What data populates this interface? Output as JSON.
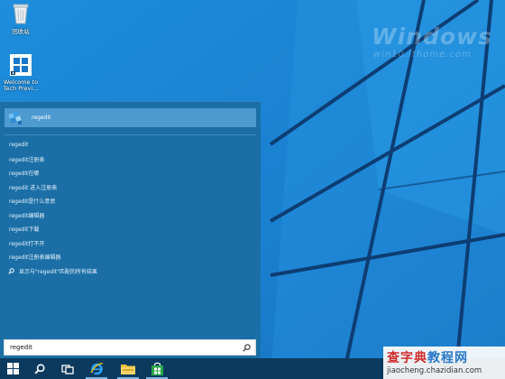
{
  "colors": {
    "desktop": "#1b86d6",
    "start_panel": "#1b6fa6",
    "selected_result": "#4d9ad0",
    "taskbar": "#0c3a5e",
    "brand_red": "#d12b2b",
    "brand_blue": "#2a78c8"
  },
  "desktop": {
    "watermark_title": "Windows",
    "watermark_url": "win10.ithome.com",
    "icons": [
      {
        "label": "回收站",
        "icon": "recycle-bin-icon"
      },
      {
        "label": "Welcome to Tech Previ...",
        "icon": "windows-logo-icon"
      }
    ]
  },
  "start": {
    "top_result": {
      "label": "regedit",
      "icon": "regedit-app-icon"
    },
    "suggestions": [
      "regedit",
      "regedit注册表",
      "regedit在哪",
      "regedit 进入注册表",
      "regedit是什么意思",
      "regedit编辑器",
      "regedit下载",
      "regedit打不开",
      "regedit注册表编辑器"
    ],
    "web_search_label": "显示与\"regedit\"匹配的所有结果",
    "search_value": "regedit"
  },
  "taskbar": {
    "items": [
      "windows-start-icon",
      "search-icon",
      "task-view-icon",
      "internet-explorer-icon",
      "file-explorer-icon",
      "windows-store-icon"
    ]
  },
  "site": {
    "brand_red": "查字典",
    "brand_blue": "教程网",
    "url": "jiaocheng.chazidian.com"
  }
}
